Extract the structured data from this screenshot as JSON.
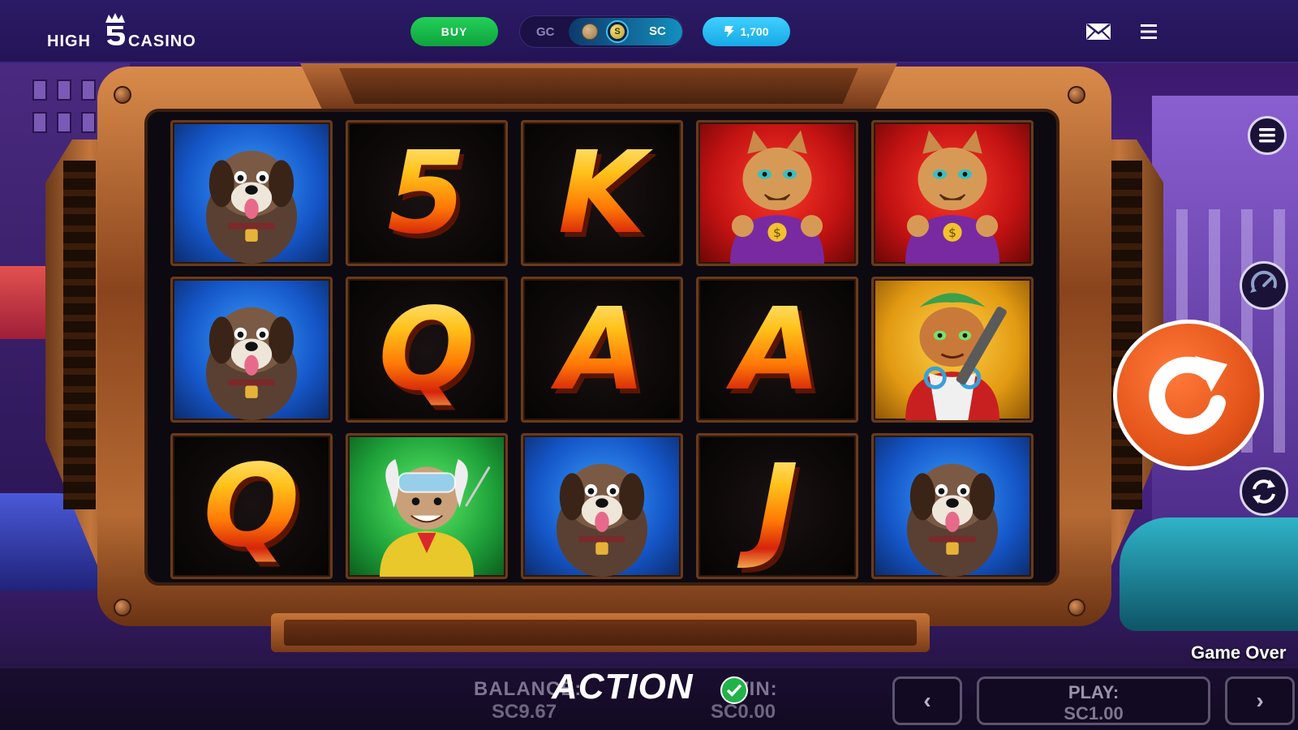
{
  "header": {
    "logo_left": "HIGH",
    "logo_right": "CASINO",
    "buy_label": "BUY",
    "currency_gc": "GC",
    "currency_sc": "SC",
    "coin_sc_symbol": "S",
    "gems_value": "1,700",
    "mail_icon": "mail-icon",
    "menu_icon": "hamburger-menu-icon"
  },
  "reels": [
    [
      {
        "type": "dog",
        "bg": "blue"
      },
      {
        "type": "dog",
        "bg": "blue"
      },
      {
        "type": "letter",
        "symbol": "Q"
      }
    ],
    [
      {
        "type": "letter",
        "symbol": "5"
      },
      {
        "type": "letter",
        "symbol": "Q"
      },
      {
        "type": "professor",
        "bg": "green"
      }
    ],
    [
      {
        "type": "letter",
        "symbol": "K"
      },
      {
        "type": "letter",
        "symbol": "A"
      },
      {
        "type": "dog",
        "bg": "blue"
      }
    ],
    [
      {
        "type": "cat",
        "bg": "red"
      },
      {
        "type": "letter",
        "symbol": "A"
      },
      {
        "type": "letter",
        "symbol": "J"
      }
    ],
    [
      {
        "type": "cat",
        "bg": "red"
      },
      {
        "type": "catgirl",
        "bg": "gold"
      },
      {
        "type": "dog",
        "bg": "blue"
      }
    ]
  ],
  "controls": {
    "menu": "menu-icon",
    "turbo": "turbo-icon",
    "spin": "spin-icon",
    "autoplay": "autoplay-icon",
    "game_over": "Game Over"
  },
  "bottom": {
    "balance_label": "BALANCE:",
    "balance_value": "SC9.67",
    "win_label": "WIN:",
    "win_value": "SC0.00",
    "watermark": "ACTION",
    "prev_label": "‹",
    "next_label": "›",
    "play_label": "PLAY:",
    "play_value": "SC1.00"
  },
  "colors": {
    "topbar": "#2b1a66",
    "buy_green": "#22d05a",
    "gem_blue": "#3ed0ff",
    "spin_orange": "#e4541a"
  }
}
